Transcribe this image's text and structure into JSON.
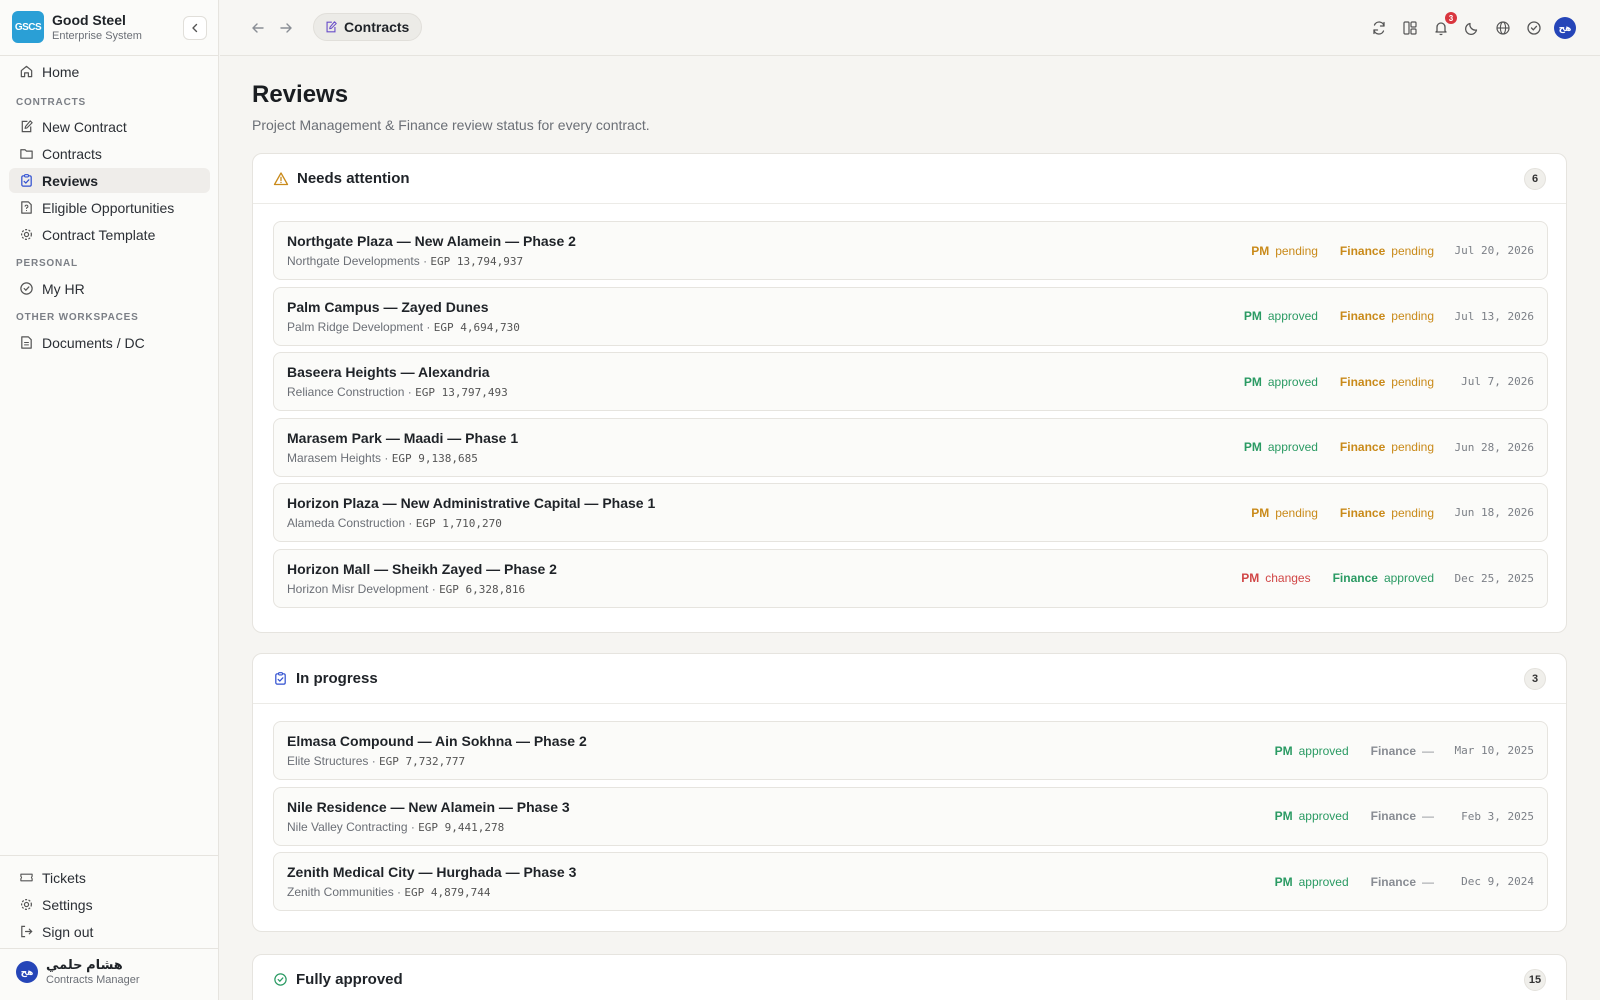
{
  "brand": {
    "logo": "GSCS",
    "name": "Good Steel",
    "subtitle": "Enterprise System"
  },
  "sidebar": {
    "home": "Home",
    "sections": {
      "contracts": "CONTRACTS",
      "personal": "PERSONAL",
      "other": "OTHER WORKSPACES"
    },
    "items": {
      "new_contract": "New Contract",
      "contracts": "Contracts",
      "reviews": "Reviews",
      "eligible": "Eligible Opportunities",
      "template": "Contract Template",
      "my_hr": "My HR",
      "documents": "Documents / DC"
    },
    "bottom": {
      "tickets": "Tickets",
      "settings": "Settings",
      "sign_out": "Sign out"
    },
    "user": {
      "initials": "هح",
      "name": "هشام حلمي",
      "role": "Contracts Manager"
    }
  },
  "topbar": {
    "breadcrumb": "Contracts",
    "notification_count": "3",
    "avatar": "هح"
  },
  "page": {
    "title": "Reviews",
    "subtitle": "Project Management & Finance review status for every contract."
  },
  "labels": {
    "pm": "PM",
    "finance": "Finance"
  },
  "sections": {
    "attention": {
      "title": "Needs attention",
      "count": "6",
      "rows": [
        {
          "title": "Northgate Plaza — New Alamein — Phase 2",
          "company": "Northgate Developments ·",
          "amount": "EGP 13,794,937",
          "pm": "pending",
          "finance": "pending",
          "date": "Jul 20, 2026"
        },
        {
          "title": "Palm Campus — Zayed Dunes",
          "company": "Palm Ridge Development ·",
          "amount": "EGP 4,694,730",
          "pm": "approved",
          "finance": "pending",
          "date": "Jul 13, 2026"
        },
        {
          "title": "Baseera Heights — Alexandria",
          "company": "Reliance Construction ·",
          "amount": "EGP 13,797,493",
          "pm": "approved",
          "finance": "pending",
          "date": "Jul 7, 2026"
        },
        {
          "title": "Marasem Park — Maadi — Phase 1",
          "company": "Marasem Heights ·",
          "amount": "EGP 9,138,685",
          "pm": "approved",
          "finance": "pending",
          "date": "Jun 28, 2026"
        },
        {
          "title": "Horizon Plaza — New Administrative Capital — Phase 1",
          "company": "Alameda Construction ·",
          "amount": "EGP 1,710,270",
          "pm": "pending",
          "finance": "pending",
          "date": "Jun 18, 2026"
        },
        {
          "title": "Horizon Mall — Sheikh Zayed — Phase 2",
          "company": "Horizon Misr Development ·",
          "amount": "EGP 6,328,816",
          "pm": "changes",
          "finance": "approved",
          "date": "Dec 25, 2025"
        }
      ]
    },
    "progress": {
      "title": "In progress",
      "count": "3",
      "rows": [
        {
          "title": "Elmasa Compound — Ain Sokhna — Phase 2",
          "company": "Elite Structures ·",
          "amount": "EGP 7,732,777",
          "pm": "approved",
          "finance": "—",
          "date": "Mar 10, 2025"
        },
        {
          "title": "Nile Residence — New Alamein — Phase 3",
          "company": "Nile Valley Contracting ·",
          "amount": "EGP 9,441,278",
          "pm": "approved",
          "finance": "—",
          "date": "Feb 3, 2025"
        },
        {
          "title": "Zenith Medical City — Hurghada — Phase 3",
          "company": "Zenith Communities ·",
          "amount": "EGP 4,879,744",
          "pm": "approved",
          "finance": "—",
          "date": "Dec 9, 2024"
        }
      ]
    },
    "approved": {
      "title": "Fully approved",
      "count": "15"
    }
  }
}
